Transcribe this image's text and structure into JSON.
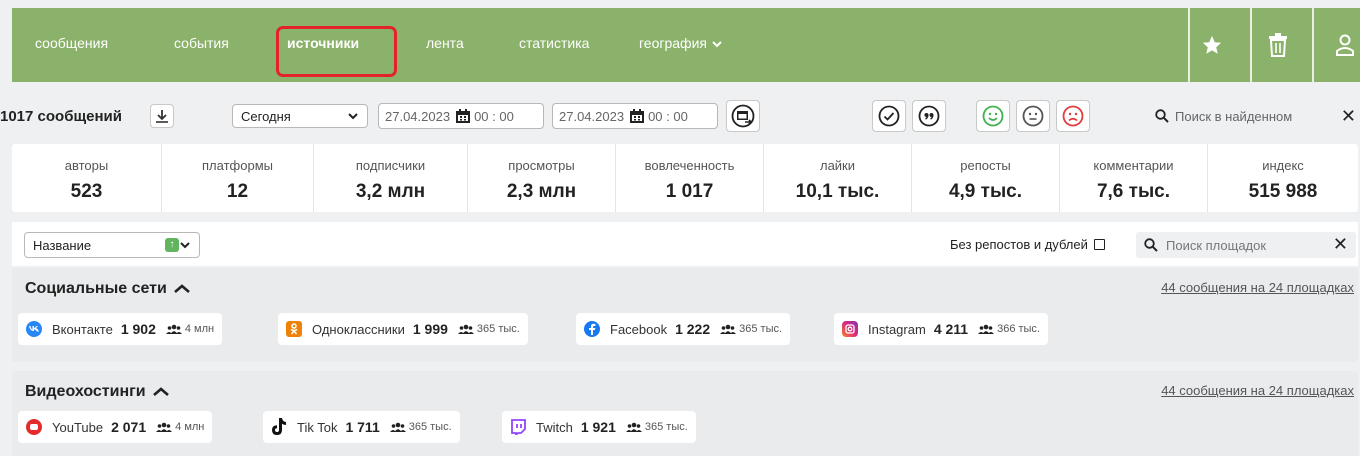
{
  "nav": {
    "items": [
      "сообщения",
      "события",
      "источники",
      "лента",
      "статистика",
      "география"
    ],
    "active": "источники",
    "accent": "#8bb26a",
    "active_outline": "#e3222a"
  },
  "toolbar": {
    "message_count": "1017 сообщений",
    "period": "Сегодня",
    "date_from": "27.04.2023",
    "time_from": "00 : 00",
    "date_to": "27.04.2023",
    "time_to": "00 : 00",
    "search_placeholder": "Поиск в найденном"
  },
  "stats": [
    {
      "label": "авторы",
      "value": "523"
    },
    {
      "label": "платформы",
      "value": "12"
    },
    {
      "label": "подписчики",
      "value": "3,2 млн"
    },
    {
      "label": "просмотры",
      "value": "2,3 млн"
    },
    {
      "label": "вовлеченность",
      "value": "1 017"
    },
    {
      "label": "лайки",
      "value": "10,1 тыс."
    },
    {
      "label": "репосты",
      "value": "4,9 тыс."
    },
    {
      "label": "комментарии",
      "value": "7,6 тыс."
    },
    {
      "label": "индекс",
      "value": "515 988"
    }
  ],
  "sort": {
    "field": "Название",
    "no_reposts_label": "Без репостов и дублей",
    "search_placeholder": "Поиск площадок"
  },
  "groups": [
    {
      "title": "Социальные сети",
      "summary": "44 сообщения на 24 площадках",
      "sources": [
        {
          "name": "Вконтакте",
          "count": "1 902",
          "audience": "4 млн",
          "icon": "vk-icon",
          "color": "#2787f5"
        },
        {
          "name": "Одноклассники",
          "count": "1 999",
          "audience": "365 тыс.",
          "icon": "odnoklassniki-icon",
          "color": "#ee8208"
        },
        {
          "name": "Facebook",
          "count": "1 222",
          "audience": "365 тыс.",
          "icon": "facebook-icon",
          "color": "#1877f2"
        },
        {
          "name": "Instagram",
          "count": "4 211",
          "audience": "366 тыс.",
          "icon": "instagram-icon",
          "color": "#d6249f"
        }
      ]
    },
    {
      "title": "Видеохостинги",
      "summary": "44 сообщения на 24 площадках",
      "sources": [
        {
          "name": "YouTube",
          "count": "2 071",
          "audience": "4 млн",
          "icon": "youtube-icon",
          "color": "#e32b2b"
        },
        {
          "name": "Tik Tok",
          "count": "1 711",
          "audience": "365 тыс.",
          "icon": "tiktok-icon",
          "color": "#111111"
        },
        {
          "name": "Twitch",
          "count": "1 921",
          "audience": "365 тыс.",
          "icon": "twitch-icon",
          "color": "#9146ff"
        }
      ]
    }
  ]
}
